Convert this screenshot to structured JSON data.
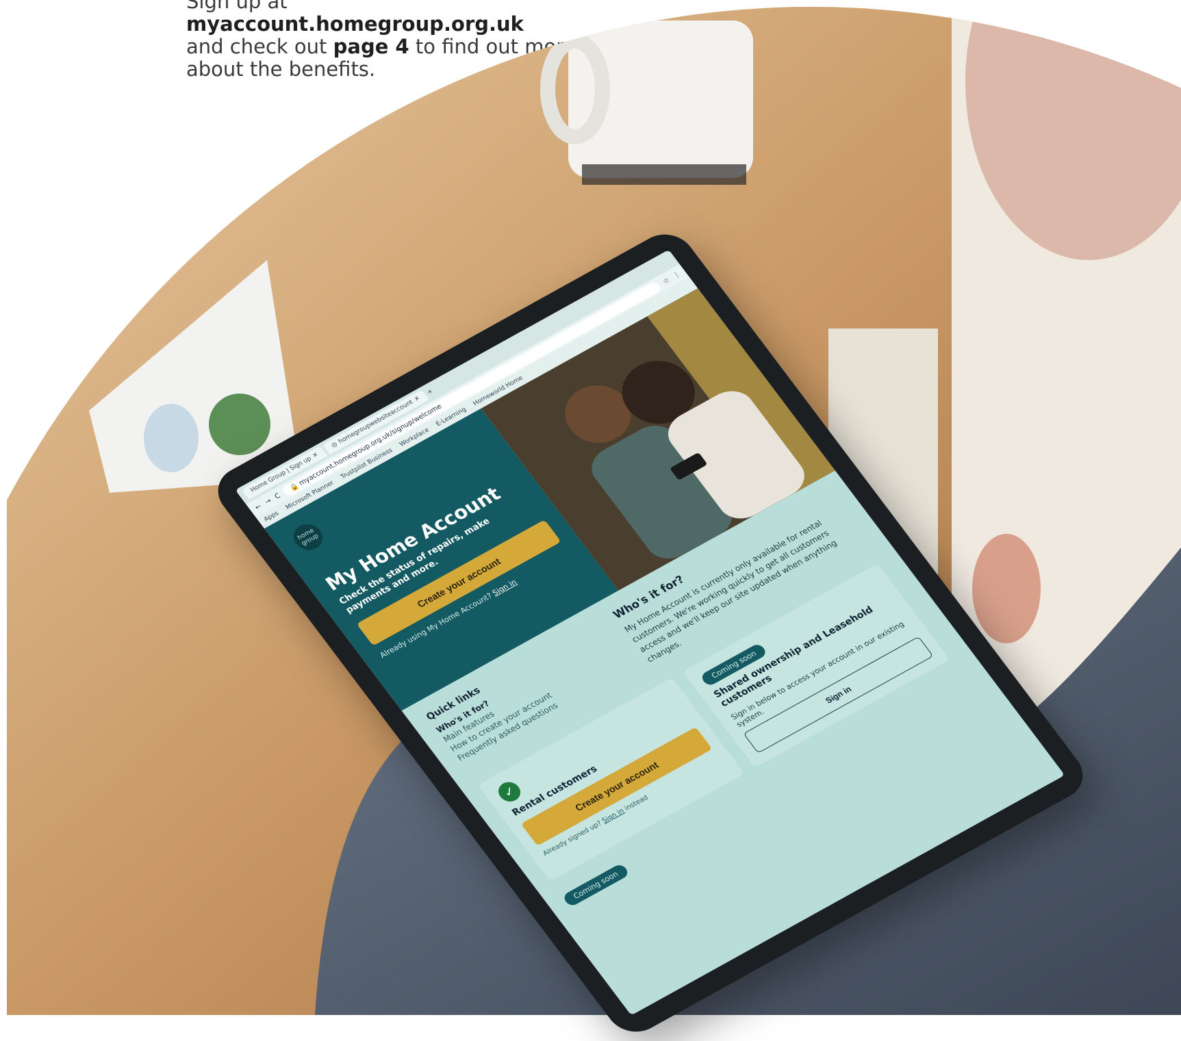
{
  "caption": {
    "line1_prefix": "Sign up at ",
    "url": "myaccount.homegroup.org.uk",
    "line2_prefix": "and check out ",
    "page_ref": "page 4",
    "line2_suffix": " to find out more",
    "line3": "about the benefits."
  },
  "browser": {
    "tab1_title": "Home Group | Sign up",
    "tab2_title": "homegroupwebsiteaccount",
    "url": "myaccount.homegroup.org.uk/signup/welcome",
    "bookmarks": [
      "Apps",
      "Microsoft Planner",
      "Trustpilot Business",
      "Workplace",
      "E-Learning",
      "Homeworld Home"
    ]
  },
  "site": {
    "logo_text": "home group",
    "hero_title": "My Home Account",
    "hero_subtitle": "Check the status of repairs, make payments and more.",
    "hero_button": "Create your account",
    "hero_already": "Already using My Home Account?",
    "hero_signin": "Sign in",
    "quick_links_title": "Quick links",
    "quick_links": [
      "Who's it for?",
      "Main features",
      "How to create your account",
      "Frequently asked questions"
    ],
    "who_title": "Who's it for?",
    "who_text": "My Home Account is currently only available for rental customers. We're working quickly to get all customers access and we'll keep our site updated when anything changes.",
    "rental": {
      "title": "Rental customers",
      "button": "Create your account",
      "note_prefix": "Already signed up?",
      "note_link": "Sign in",
      "note_suffix": "instead"
    },
    "shared": {
      "badge": "Coming soon",
      "title": "Shared ownership and Leasehold customers",
      "text": "Sign in below to access your account in our existing system.",
      "button": "Sign in"
    },
    "bottom_badge": "Coming soon"
  },
  "colors": {
    "teal": "#145a62",
    "mint": "#b9ddd8",
    "yellow": "#d5a83a",
    "check_green": "#1d7a3c"
  }
}
